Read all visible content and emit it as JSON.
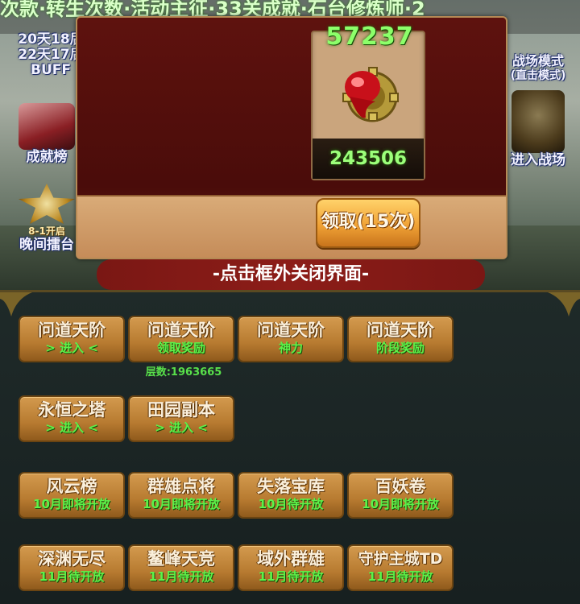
{
  "marquee": "次款·转生次数·活动主征·33关成就·石台修炼师·2",
  "reward": {
    "top_number": "57237",
    "count": "243506",
    "claim_label": "领取(15次)"
  },
  "close_hint": "-点击框外关闭界面-",
  "left_side": {
    "buff_line1": "20天18后",
    "buff_line2": "22天17后",
    "buff_line3": "BUFF",
    "achievement_label": "成就榜",
    "star_tag": "8-1开启",
    "star_label": "晚间擂台"
  },
  "right_side": {
    "battle_line1": "战场模式",
    "battle_line2": "(直击模式)",
    "enter_label": "进入战场"
  },
  "activities": [
    {
      "name": "问道天阶",
      "sub": "> 进入 <"
    },
    {
      "name": "问道天阶",
      "sub": "领取奖励"
    },
    {
      "name": "问道天阶",
      "sub": "神力"
    },
    {
      "name": "问道天阶",
      "sub": "阶段奖励"
    },
    {
      "name": "永恒之塔",
      "sub": "> 进入 <"
    },
    {
      "name": "田园副本",
      "sub": "> 进入 <"
    },
    {
      "name": "风云榜",
      "sub": "10月即将开放"
    },
    {
      "name": "群雄点将",
      "sub": "10月即将开放"
    },
    {
      "name": "失落宝库",
      "sub": "10月待开放"
    },
    {
      "name": "百妖卷",
      "sub": "10月即将开放"
    },
    {
      "name": "深渊无尽",
      "sub": "11月待开放"
    },
    {
      "name": "鳌峰天竞",
      "sub": "11月待开放"
    },
    {
      "name": "域外群雄",
      "sub": "11月待开放"
    },
    {
      "name": "守护主城TD",
      "sub": "11月待开放"
    }
  ],
  "floor_text": "层数:1963665"
}
